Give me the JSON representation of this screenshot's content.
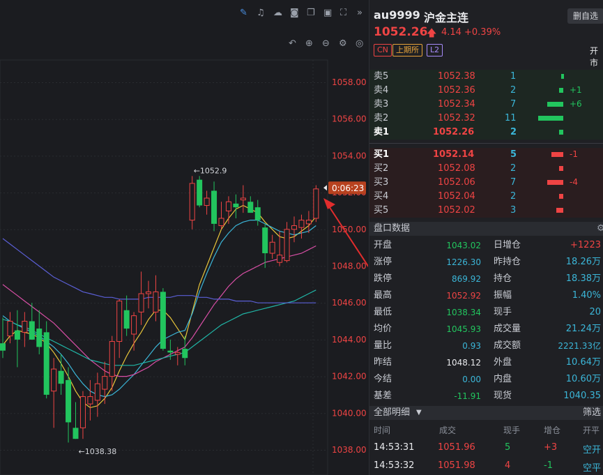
{
  "toolbar": {
    "icons": [
      "pen-icon",
      "bell-icon",
      "cloud-icon",
      "camera-icon",
      "copy-icon",
      "screen-icon",
      "expand-icon",
      "collapse-icon"
    ],
    "icons2": [
      "undo-icon",
      "zoom-in-icon",
      "zoom-out-icon",
      "settings-icon",
      "target-icon"
    ]
  },
  "chart": {
    "price_ticks": [
      "1058.00",
      "1056.00",
      "1054.00",
      "1052.00",
      "1050.00",
      "1048.00",
      "1046.00",
      "1044.00",
      "1042.00",
      "1040.00",
      "1038.00"
    ],
    "current_price_label": "0:06:23",
    "high_label": "←1052.9",
    "low_label": "←1038.38"
  },
  "chart_data": {
    "type": "candlestick",
    "ylim": [
      1037.6,
      1058.9
    ],
    "candles": [
      {
        "o": 1043.8,
        "h": 1045.2,
        "l": 1043.0,
        "c": 1043.4
      },
      {
        "o": 1044.2,
        "h": 1045.5,
        "l": 1043.8,
        "c": 1045.0
      },
      {
        "o": 1044.5,
        "h": 1045.6,
        "l": 1042.5,
        "c": 1044.0
      },
      {
        "o": 1044.4,
        "h": 1045.5,
        "l": 1043.6,
        "c": 1045.0
      },
      {
        "o": 1045.0,
        "h": 1046.0,
        "l": 1044.0,
        "c": 1044.0
      },
      {
        "o": 1044.6,
        "h": 1045.6,
        "l": 1043.2,
        "c": 1043.6
      },
      {
        "o": 1044.4,
        "h": 1045.0,
        "l": 1040.8,
        "c": 1041.0
      },
      {
        "o": 1041.2,
        "h": 1043.0,
        "l": 1039.2,
        "c": 1042.4
      },
      {
        "o": 1042.3,
        "h": 1043.2,
        "l": 1041.0,
        "c": 1041.6
      },
      {
        "o": 1041.8,
        "h": 1042.5,
        "l": 1038.4,
        "c": 1039.5
      },
      {
        "o": 1039.2,
        "h": 1040.6,
        "l": 1038.6,
        "c": 1038.6
      },
      {
        "o": 1039.2,
        "h": 1041.2,
        "l": 1038.6,
        "c": 1040.9
      },
      {
        "o": 1040.5,
        "h": 1041.8,
        "l": 1039.6,
        "c": 1040.9
      },
      {
        "o": 1040.7,
        "h": 1042.2,
        "l": 1039.8,
        "c": 1041.6
      },
      {
        "o": 1041.3,
        "h": 1042.8,
        "l": 1040.5,
        "c": 1042.0
      },
      {
        "o": 1042.0,
        "h": 1044.2,
        "l": 1041.2,
        "c": 1043.9
      },
      {
        "o": 1043.9,
        "h": 1046.2,
        "l": 1043.0,
        "c": 1046.1
      },
      {
        "o": 1045.6,
        "h": 1046.4,
        "l": 1044.2,
        "c": 1044.6
      },
      {
        "o": 1044.3,
        "h": 1045.5,
        "l": 1043.4,
        "c": 1045.3
      },
      {
        "o": 1045.5,
        "h": 1047.7,
        "l": 1044.8,
        "c": 1046.5
      },
      {
        "o": 1046.5,
        "h": 1047.2,
        "l": 1045.7,
        "c": 1046.6
      },
      {
        "o": 1045.5,
        "h": 1047.5,
        "l": 1045.0,
        "c": 1046.6
      },
      {
        "o": 1046.6,
        "h": 1046.8,
        "l": 1043.4,
        "c": 1043.5
      },
      {
        "o": 1043.4,
        "h": 1044.0,
        "l": 1042.9,
        "c": 1043.3
      },
      {
        "o": 1043.2,
        "h": 1043.6,
        "l": 1042.6,
        "c": 1043.3
      },
      {
        "o": 1043.5,
        "h": 1044.2,
        "l": 1042.6,
        "c": 1043.0
      },
      {
        "o": 1050.5,
        "h": 1052.9,
        "l": 1050.0,
        "c": 1052.5
      },
      {
        "o": 1052.7,
        "h": 1052.9,
        "l": 1051.2,
        "c": 1051.3
      },
      {
        "o": 1051.3,
        "h": 1052.1,
        "l": 1050.8,
        "c": 1051.7
      },
      {
        "o": 1052.1,
        "h": 1052.6,
        "l": 1049.9,
        "c": 1050.3
      },
      {
        "o": 1050.2,
        "h": 1051.5,
        "l": 1050.0,
        "c": 1050.6
      },
      {
        "o": 1051.0,
        "h": 1051.8,
        "l": 1050.3,
        "c": 1051.5
      },
      {
        "o": 1051.4,
        "h": 1051.9,
        "l": 1050.6,
        "c": 1051.2
      },
      {
        "o": 1051.6,
        "h": 1052.4,
        "l": 1050.9,
        "c": 1051.7
      },
      {
        "o": 1051.5,
        "h": 1051.8,
        "l": 1050.9,
        "c": 1050.9
      },
      {
        "o": 1051.2,
        "h": 1051.6,
        "l": 1050.2,
        "c": 1050.5
      },
      {
        "o": 1050.1,
        "h": 1050.3,
        "l": 1047.9,
        "c": 1048.7
      },
      {
        "o": 1048.7,
        "h": 1049.7,
        "l": 1048.4,
        "c": 1049.3
      },
      {
        "o": 1048.2,
        "h": 1049.9,
        "l": 1048.0,
        "c": 1048.6
      },
      {
        "o": 1048.3,
        "h": 1050.4,
        "l": 1048.2,
        "c": 1050.0
      },
      {
        "o": 1050.0,
        "h": 1050.7,
        "l": 1049.3,
        "c": 1050.2
      },
      {
        "o": 1050.1,
        "h": 1050.8,
        "l": 1049.5,
        "c": 1050.5
      },
      {
        "o": 1050.3,
        "h": 1051.0,
        "l": 1049.8,
        "c": 1050.5
      },
      {
        "o": 1050.6,
        "h": 1052.4,
        "l": 1050.4,
        "c": 1052.2
      }
    ],
    "ma_lines": [
      {
        "name": "MA5",
        "color": "#e8c53a",
        "values": [
          1043.7,
          1044.2,
          1044.5,
          1044.4,
          1044.3,
          1044.1,
          1043.8,
          1043.3,
          1042.7,
          1042.0,
          1041.2,
          1040.6,
          1040.3,
          1040.4,
          1040.8,
          1041.4,
          1042.3,
          1043.1,
          1043.8,
          1044.4,
          1045.1,
          1045.6,
          1045.6,
          1045.2,
          1044.6,
          1044.0,
          1045.5,
          1047.0,
          1048.0,
          1049.0,
          1050.0,
          1050.6,
          1051.1,
          1051.3,
          1051.1,
          1050.9,
          1050.4,
          1050.0,
          1049.6,
          1049.5,
          1049.6,
          1049.9,
          1050.2,
          1050.7
        ]
      },
      {
        "name": "MA10",
        "color": "#3bb6d8",
        "values": [
          1045.3,
          1045.0,
          1044.8,
          1044.6,
          1044.4,
          1044.2,
          1043.9,
          1043.6,
          1043.2,
          1042.7,
          1042.1,
          1041.6,
          1041.2,
          1041.0,
          1040.9,
          1041.0,
          1041.3,
          1041.7,
          1042.1,
          1042.6,
          1043.1,
          1043.6,
          1044.0,
          1044.2,
          1044.4,
          1044.5,
          1045.4,
          1046.6,
          1047.6,
          1048.5,
          1049.3,
          1049.8,
          1050.2,
          1050.4,
          1050.5,
          1050.5,
          1050.3,
          1050.1,
          1049.9,
          1049.8,
          1049.7,
          1049.8,
          1049.9,
          1050.2
        ]
      },
      {
        "name": "MA20",
        "color": "#d94fa6",
        "values": [
          1047.0,
          1046.7,
          1046.4,
          1046.1,
          1045.8,
          1045.5,
          1045.2,
          1044.9,
          1044.5,
          1044.1,
          1043.7,
          1043.3,
          1042.9,
          1042.6,
          1042.3,
          1042.1,
          1042.0,
          1042.0,
          1042.1,
          1042.3,
          1042.5,
          1042.8,
          1043.0,
          1043.2,
          1043.4,
          1043.6,
          1044.1,
          1044.7,
          1045.3,
          1045.9,
          1046.4,
          1046.9,
          1047.3,
          1047.6,
          1047.8,
          1048.0,
          1048.2,
          1048.3,
          1048.4,
          1048.5,
          1048.6,
          1048.7,
          1048.9,
          1049.1
        ]
      },
      {
        "name": "MA40",
        "color": "#20b5a6",
        "values": [
          1045.1,
          1045.0,
          1044.8,
          1044.7,
          1044.5,
          1044.3,
          1044.1,
          1043.9,
          1043.7,
          1043.5,
          1043.3,
          1043.1,
          1042.9,
          1042.8,
          1042.7,
          1042.6,
          1042.6,
          1042.6,
          1042.6,
          1042.7,
          1042.8,
          1042.9,
          1043.0,
          1043.1,
          1043.2,
          1043.3,
          1043.6,
          1043.9,
          1044.2,
          1044.5,
          1044.8,
          1045.0,
          1045.2,
          1045.4,
          1045.5,
          1045.6,
          1045.7,
          1045.8,
          1045.9,
          1046.0,
          1046.1,
          1046.3,
          1046.5,
          1046.7
        ]
      },
      {
        "name": "MA60",
        "color": "#5b5fd6",
        "values": [
          1049.5,
          1049.2,
          1048.9,
          1048.6,
          1048.3,
          1048.0,
          1047.7,
          1047.4,
          1047.2,
          1047.0,
          1046.8,
          1046.6,
          1046.5,
          1046.4,
          1046.3,
          1046.3,
          1046.2,
          1046.2,
          1046.2,
          1046.2,
          1046.3,
          1046.3,
          1046.3,
          1046.3,
          1046.4,
          1046.4,
          1046.4,
          1046.3,
          1046.3,
          1046.2,
          1046.2,
          1046.2,
          1046.1,
          1046.1,
          1046.1,
          1046.0,
          1046.0,
          1046.0,
          1046.0,
          1046.0,
          1046.0,
          1046.0,
          1046.0,
          1046.0
        ]
      }
    ]
  },
  "quote": {
    "symbol": "au9999",
    "name": "沪金主连",
    "price": "1052.26",
    "change": "4.14",
    "change_pct": "+0.39%",
    "delete_button": "删自选",
    "badges": [
      "CN",
      "上期所",
      "L2"
    ],
    "open_label": "开市"
  },
  "orderbook": {
    "asks": [
      {
        "label": "卖5",
        "price": "1052.38",
        "vol": "1",
        "delta": "",
        "bar": 0.04
      },
      {
        "label": "卖4",
        "price": "1052.36",
        "vol": "2",
        "delta": "+1",
        "bar": 0.09
      },
      {
        "label": "卖3",
        "price": "1052.34",
        "vol": "7",
        "delta": "+6",
        "bar": 0.32
      },
      {
        "label": "卖2",
        "price": "1052.32",
        "vol": "11",
        "delta": "",
        "bar": 0.5
      },
      {
        "label": "卖1",
        "price": "1052.26",
        "vol": "2",
        "delta": "",
        "bar": 0.09
      }
    ],
    "bids": [
      {
        "label": "买1",
        "price": "1052.14",
        "vol": "5",
        "delta": "-1",
        "bar": 0.23
      },
      {
        "label": "买2",
        "price": "1052.08",
        "vol": "2",
        "delta": "",
        "bar": 0.09
      },
      {
        "label": "买3",
        "price": "1052.06",
        "vol": "7",
        "delta": "-4",
        "bar": 0.32
      },
      {
        "label": "买4",
        "price": "1052.04",
        "vol": "2",
        "delta": "",
        "bar": 0.09
      },
      {
        "label": "买5",
        "price": "1052.02",
        "vol": "3",
        "delta": "",
        "bar": 0.14
      }
    ]
  },
  "panel": {
    "title": "盘口数据",
    "left": [
      {
        "label": "开盘",
        "value": "1043.02",
        "color": "green"
      },
      {
        "label": "涨停",
        "value": "1226.30",
        "color": "cyan"
      },
      {
        "label": "跌停",
        "value": "869.92",
        "color": "cyan"
      },
      {
        "label": "最高",
        "value": "1052.92",
        "color": "red"
      },
      {
        "label": "最低",
        "value": "1038.34",
        "color": "green"
      },
      {
        "label": "均价",
        "value": "1045.93",
        "color": "green"
      },
      {
        "label": "量比",
        "value": "0.93",
        "color": "cyan"
      },
      {
        "label": "昨结",
        "value": "1048.12",
        "color": "white"
      },
      {
        "label": "今结",
        "value": "0.00",
        "color": "cyan"
      },
      {
        "label": "基差",
        "value": "-11.91",
        "color": "green"
      }
    ],
    "right": [
      {
        "label": "日增仓",
        "value": "+1223",
        "color": "red"
      },
      {
        "label": "昨持仓",
        "value": "18.26万",
        "color": "cyan"
      },
      {
        "label": "持仓",
        "value": "18.38万",
        "color": "cyan"
      },
      {
        "label": "振幅",
        "value": "1.40%",
        "color": "cyan"
      },
      {
        "label": "现手",
        "value": "20",
        "color": "cyan"
      },
      {
        "label": "成交量",
        "value": "21.24万",
        "color": "cyan"
      },
      {
        "label": "成交额",
        "value": "2221.33亿",
        "color": "cyan"
      },
      {
        "label": "外盘",
        "value": "10.64万",
        "color": "cyan"
      },
      {
        "label": "内盘",
        "value": "10.60万",
        "color": "cyan"
      },
      {
        "label": "现货",
        "value": "1040.35",
        "color": "cyan"
      }
    ]
  },
  "trades": {
    "title": "全部明细",
    "filter": "筛选",
    "headers": [
      "时间",
      "成交",
      "现手",
      "增仓",
      "开平"
    ],
    "rows": [
      {
        "time": "14:53:31",
        "price": "1051.96",
        "vol": "5",
        "oi": "+3",
        "type": "空开"
      },
      {
        "time": "14:53:32",
        "price": "1051.98",
        "vol": "4",
        "oi": "-1",
        "type": "空平"
      }
    ]
  },
  "colors": {
    "up": "#ef4444",
    "down": "#22c55e",
    "accent": "#3bb6d8"
  }
}
